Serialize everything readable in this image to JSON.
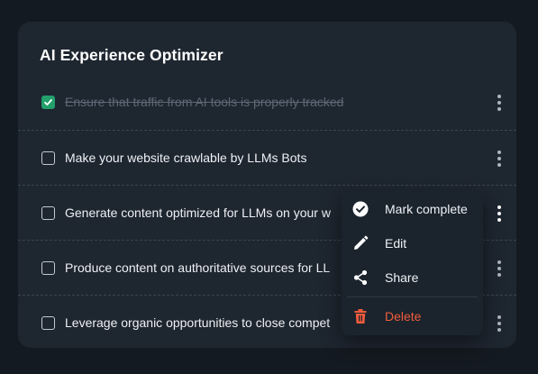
{
  "card": {
    "title": "AI Experience Optimizer"
  },
  "tasks": [
    {
      "label": "Ensure that traffic from AI tools is properly tracked",
      "completed": true
    },
    {
      "label": "Make your website crawlable by LLMs Bots",
      "completed": false
    },
    {
      "label": "Generate content optimized for LLMs on your w",
      "completed": false
    },
    {
      "label": "Produce content on authoritative sources for LL",
      "completed": false
    },
    {
      "label": "Leverage organic opportunities to close compet",
      "completed": false
    }
  ],
  "menu": {
    "items": [
      {
        "label": "Mark complete",
        "icon": "check-circle-icon"
      },
      {
        "label": "Edit",
        "icon": "pencil-icon"
      },
      {
        "label": "Share",
        "icon": "share-icon"
      },
      {
        "label": "Delete",
        "icon": "trash-icon"
      }
    ]
  },
  "colors": {
    "background": "#141a21",
    "card": "#1e2630",
    "checked": "#22a06b",
    "danger": "#ef5b3c",
    "text": "#eef1f5",
    "muted": "#5e6774"
  }
}
